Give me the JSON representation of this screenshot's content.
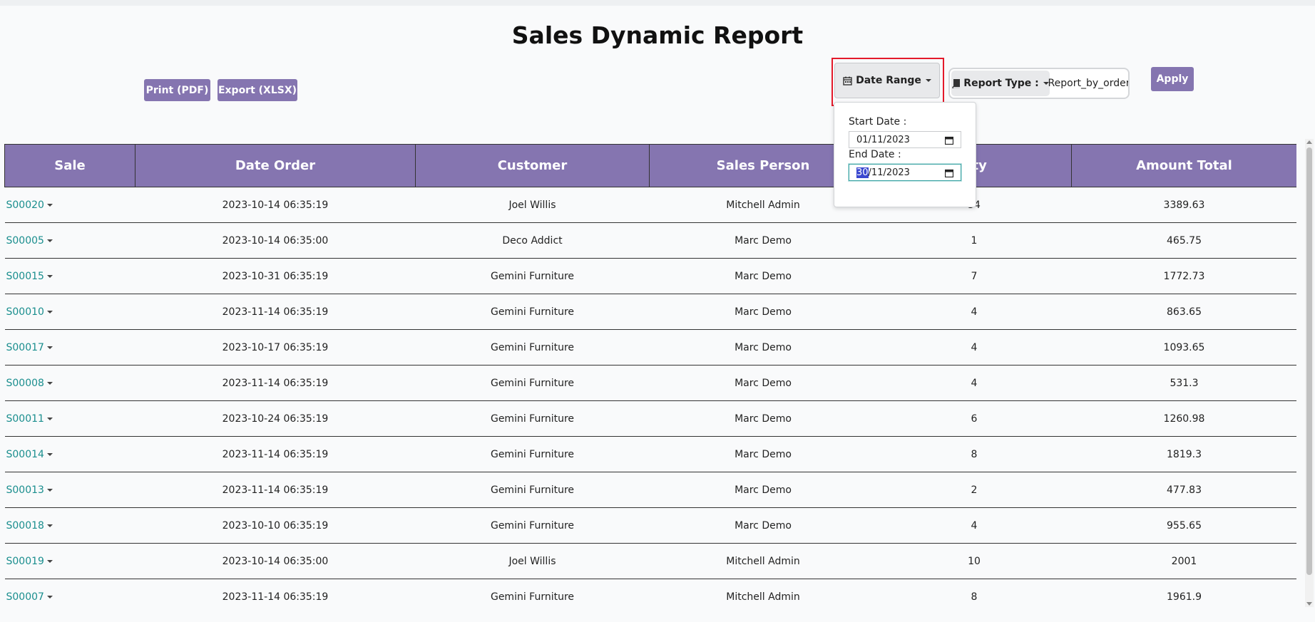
{
  "page": {
    "title": "Sales Dynamic Report"
  },
  "actions": {
    "print_label": "Print (PDF)",
    "export_label": "Export (XLSX)",
    "apply_label": "Apply"
  },
  "filters": {
    "date_range_label": "Date Range",
    "date_range_icon": "calendar-icon",
    "report_type_label": "Report Type :",
    "report_type_icon": "book-icon",
    "report_type_value": "Report_by_order",
    "start_date_label": "Start Date :",
    "start_date_value": "01/11/2023",
    "end_date_label": "End Date :",
    "end_date_day_selected": "30",
    "end_date_rest": "/11/2023"
  },
  "table": {
    "columns": [
      "Sale",
      "Date Order",
      "Customer",
      "Sales Person",
      "Qty",
      "Amount Total"
    ],
    "rows": [
      {
        "sale": "S00020",
        "date": "2023-10-14 06:35:19",
        "customer": "Joel Willis",
        "salesperson": "Mitchell Admin",
        "qty": "34",
        "amount": "3389.63"
      },
      {
        "sale": "S00005",
        "date": "2023-10-14 06:35:00",
        "customer": "Deco Addict",
        "salesperson": "Marc Demo",
        "qty": "1",
        "amount": "465.75"
      },
      {
        "sale": "S00015",
        "date": "2023-10-31 06:35:19",
        "customer": "Gemini Furniture",
        "salesperson": "Marc Demo",
        "qty": "7",
        "amount": "1772.73"
      },
      {
        "sale": "S00010",
        "date": "2023-11-14 06:35:19",
        "customer": "Gemini Furniture",
        "salesperson": "Marc Demo",
        "qty": "4",
        "amount": "863.65"
      },
      {
        "sale": "S00017",
        "date": "2023-10-17 06:35:19",
        "customer": "Gemini Furniture",
        "salesperson": "Marc Demo",
        "qty": "4",
        "amount": "1093.65"
      },
      {
        "sale": "S00008",
        "date": "2023-11-14 06:35:19",
        "customer": "Gemini Furniture",
        "salesperson": "Marc Demo",
        "qty": "4",
        "amount": "531.3"
      },
      {
        "sale": "S00011",
        "date": "2023-10-24 06:35:19",
        "customer": "Gemini Furniture",
        "salesperson": "Marc Demo",
        "qty": "6",
        "amount": "1260.98"
      },
      {
        "sale": "S00014",
        "date": "2023-11-14 06:35:19",
        "customer": "Gemini Furniture",
        "salesperson": "Marc Demo",
        "qty": "8",
        "amount": "1819.3"
      },
      {
        "sale": "S00013",
        "date": "2023-11-14 06:35:19",
        "customer": "Gemini Furniture",
        "salesperson": "Marc Demo",
        "qty": "2",
        "amount": "477.83"
      },
      {
        "sale": "S00018",
        "date": "2023-10-10 06:35:19",
        "customer": "Gemini Furniture",
        "salesperson": "Marc Demo",
        "qty": "4",
        "amount": "955.65"
      },
      {
        "sale": "S00019",
        "date": "2023-10-14 06:35:00",
        "customer": "Joel Willis",
        "salesperson": "Mitchell Admin",
        "qty": "10",
        "amount": "2001"
      },
      {
        "sale": "S00007",
        "date": "2023-11-14 06:35:19",
        "customer": "Gemini Furniture",
        "salesperson": "Mitchell Admin",
        "qty": "8",
        "amount": "1961.9"
      }
    ]
  },
  "colors": {
    "header_purple": "#8575b0",
    "link_teal": "#1a8e8e",
    "highlight_red": "#e3192a"
  }
}
